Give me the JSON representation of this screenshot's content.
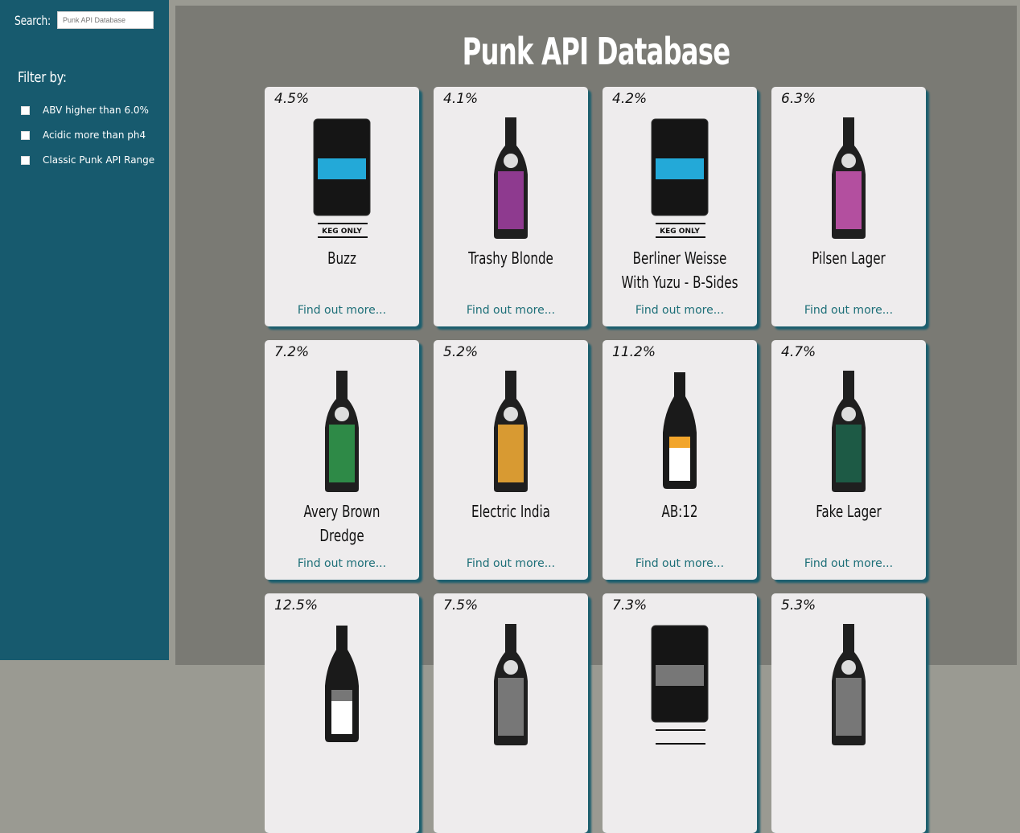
{
  "sidebar": {
    "search_label": "Search:",
    "search_placeholder": "Punk API Database",
    "filter_title": "Filter by:",
    "filters": [
      "ABV higher than 6.0%",
      "Acidic more than ph4",
      "Classic Punk API Range"
    ]
  },
  "main": {
    "title": "Punk API Database",
    "link_text": "Find out more...",
    "beers": [
      {
        "abv": "4.5%",
        "name": "Buzz",
        "image": "keg",
        "label": "KEG ONLY",
        "label_color": "#23a9d8"
      },
      {
        "abv": "4.1%",
        "name": "Trashy Blonde",
        "image": "bottle",
        "label_color": "#8e3a8f"
      },
      {
        "abv": "4.2%",
        "name": "Berliner Weisse With Yuzu - B-Sides",
        "image": "keg",
        "label": "KEG ONLY",
        "label_color": "#23a9d8"
      },
      {
        "abv": "6.3%",
        "name": "Pilsen Lager",
        "image": "bottle",
        "label_color": "#b34f9f"
      },
      {
        "abv": "7.2%",
        "name": "Avery Brown Dredge",
        "image": "bottle",
        "label_color": "#2e8a47"
      },
      {
        "abv": "5.2%",
        "name": "Electric India",
        "image": "bottle",
        "label_color": "#d89a32"
      },
      {
        "abv": "11.2%",
        "name": "AB:12",
        "image": "champagne",
        "label_color": "#f2a52b"
      },
      {
        "abv": "4.7%",
        "name": "Fake Lager",
        "image": "bottle",
        "label_color": "#1d5a45"
      },
      {
        "abv": "12.5%",
        "name": "",
        "image": "champagne"
      },
      {
        "abv": "7.5%",
        "name": "",
        "image": "bottle"
      },
      {
        "abv": "7.3%",
        "name": "",
        "image": "keg"
      },
      {
        "abv": "5.3%",
        "name": "",
        "image": "bottle"
      }
    ]
  }
}
